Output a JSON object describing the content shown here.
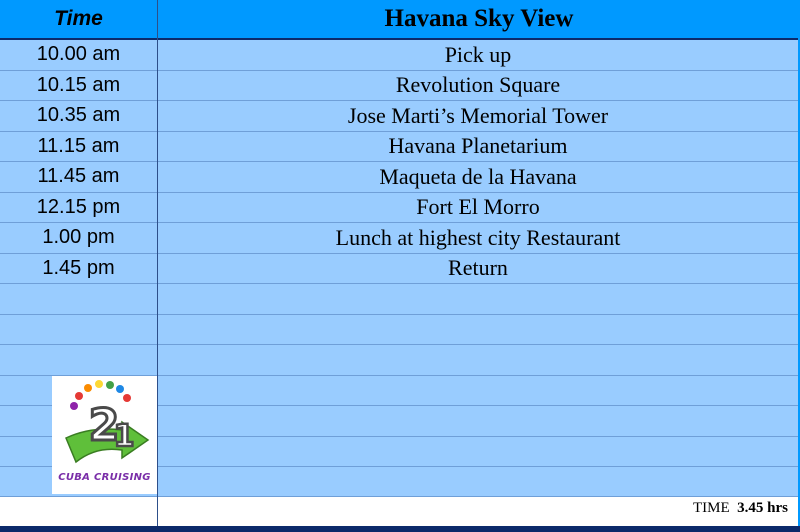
{
  "header": {
    "time_label": "Time",
    "title": "Havana Sky View"
  },
  "itinerary": [
    {
      "time": "10.00 am",
      "activity": "Pick up"
    },
    {
      "time": "10.15 am",
      "activity": "Revolution Square"
    },
    {
      "time": "10.35 am",
      "activity": "Jose Marti’s Memorial Tower"
    },
    {
      "time": "11.15 am",
      "activity": "Havana Planetarium"
    },
    {
      "time": "11.45 am",
      "activity": "Maqueta de la Havana"
    },
    {
      "time": "12.15 pm",
      "activity": "Fort El Morro"
    },
    {
      "time": "1.00 pm",
      "activity": "Lunch at highest city Restaurant"
    },
    {
      "time": "1.45 pm",
      "activity": "Return"
    }
  ],
  "footer": {
    "total_label": "TIME",
    "total_value": "3.45 hrs"
  },
  "logo": {
    "text": "CUBA CRUISING",
    "icon": "cuba-cruising-logo-icon"
  },
  "colors": {
    "header_bg": "#0099ff",
    "table_bg": "#99ccff",
    "border": "#0c2a6a"
  }
}
